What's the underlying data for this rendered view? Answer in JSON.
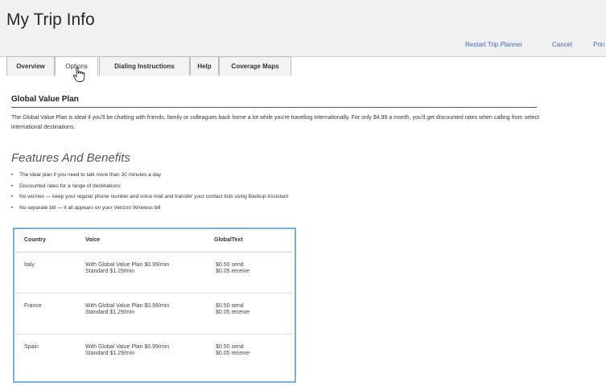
{
  "app": {
    "title": "My Trip Info"
  },
  "header": {
    "links": [
      "Restart Trip Planner",
      "Cancel",
      "Prin"
    ]
  },
  "tabs": [
    {
      "label": "Overview",
      "active": false
    },
    {
      "label": "Options",
      "active": true
    },
    {
      "label": "Dialing Instructions",
      "active": false
    },
    {
      "label": "Help",
      "active": false
    },
    {
      "label": "Coverage Maps",
      "active": false
    }
  ],
  "plan": {
    "title": "Global Value Plan",
    "description": "The Global Value Plan is ideal if you'll be chatting with friends, family or colleagues back home a lot while you're traveling internationally. For only $4.99 a month, you'll get discounted rates when calling from select international destinations."
  },
  "features": {
    "heading": "Features And Benefits",
    "items": [
      "The ideal plan if you need to talk more than 30 minutes a day",
      "Discounted rates for a range of destinations",
      "No worries — keep your regular phone number and voice mail and transfer your contact lists using Backup Assistant",
      "No separate bill — it all appears on your Verizon Wireless bill"
    ]
  },
  "rates_table": {
    "headers": [
      "Country",
      "Voice",
      "GlobalText"
    ],
    "rows": [
      {
        "country": "Italy",
        "voice": [
          "With Global Value Plan $0.99/min",
          "Standard $1.29/min"
        ],
        "text": [
          "$0.50 send",
          "$0.05 receive"
        ]
      },
      {
        "country": "France",
        "voice": [
          "With Global Value Plan $0.99/min",
          "Standard $1.29/min"
        ],
        "text": [
          "$0.50 send",
          "$0.05 receive"
        ]
      },
      {
        "country": "Spain",
        "voice": [
          "With Global Value Plan $0.99/min",
          "Standard $1.29/min"
        ],
        "text": [
          "$0.50 send",
          "$0.05 receive"
        ]
      }
    ]
  },
  "colors": {
    "link": "#3f6bb5",
    "table_border": "#7aaedb",
    "header_band": "#f1f1f1"
  },
  "icons": {
    "cursor": "hand-pointer-icon"
  }
}
